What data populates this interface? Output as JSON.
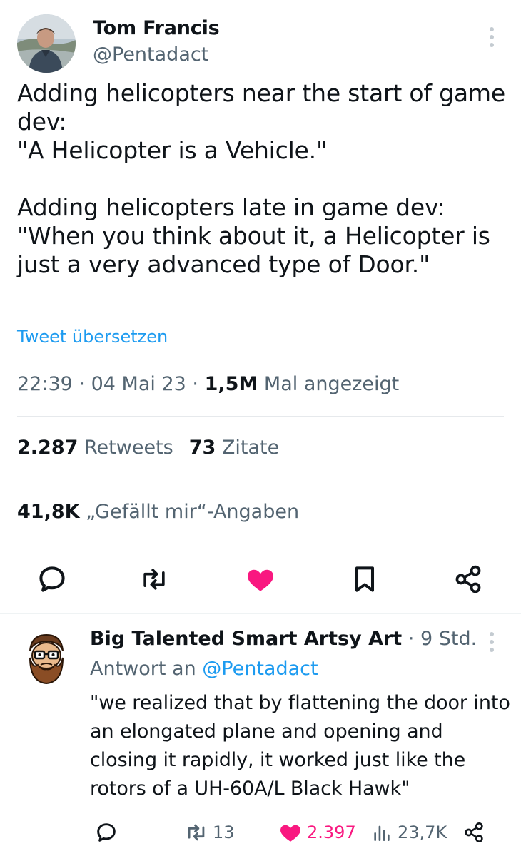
{
  "tweet": {
    "author_name": "Tom Francis",
    "author_handle": "@Pentadact",
    "text": "Adding helicopters near the start of game dev:\n\"A Helicopter is a Vehicle.\"\n\nAdding helicopters late in game dev:\n\"When you think about it, a Helicopter is just a very advanced type of Door.\"",
    "translate_label": "Tweet übersetzen",
    "time": "22:39",
    "date": "04 Mai 23",
    "views_count": "1,5M",
    "views_label": "Mal angezeigt",
    "separator": "·",
    "retweets_count": "2.287",
    "retweets_label": "Retweets",
    "quotes_count": "73",
    "quotes_label": "Zitate",
    "likes_count": "41,8K",
    "likes_label": "„Gefällt mir“-Angaben",
    "liked": true
  },
  "reply": {
    "author_name": "Big Talented Smart Artsy Art",
    "separator": "·",
    "age": "9 Std.",
    "reply_prefix": "Antwort an",
    "reply_mention": "@Pentadact",
    "text": "\"we realized that by flattening the door into an elongated plane and opening and closing it rapidly, it worked just like the rotors of a UH-60A/L Black Hawk\"",
    "retweets": "13",
    "likes": "2.397",
    "views": "23,7K",
    "liked": true
  },
  "icons": {
    "reply": "speech-bubble-icon",
    "retweet": "retweet-arrows-icon",
    "like": "heart-icon",
    "bookmark": "bookmark-icon",
    "share": "share-nodes-icon",
    "views": "bar-chart-icon",
    "more": "vertical-ellipsis-icon"
  },
  "colors": {
    "text": "#0f1419",
    "muted": "#536471",
    "link": "#1d9bf0",
    "like": "#f91880",
    "divider": "#eff3f4"
  }
}
